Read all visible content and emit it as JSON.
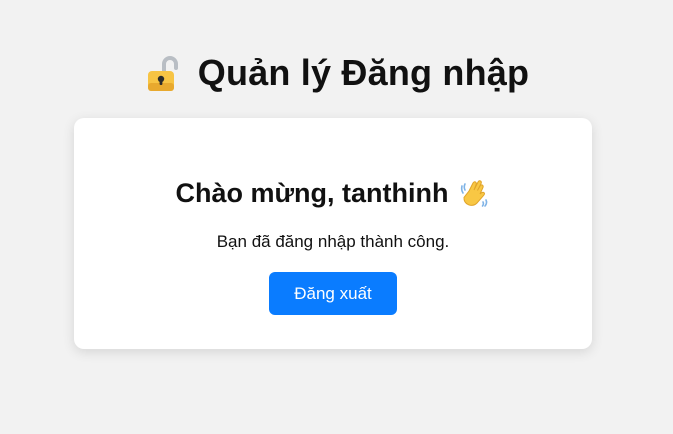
{
  "header": {
    "icon": "lock-icon",
    "title": "Quản lý Đăng nhập"
  },
  "card": {
    "welcome": "Chào mừng, tanthinh",
    "welcome_icon": "waving-hand-icon",
    "message": "Bạn đã đăng nhập thành công.",
    "logout_label": "Đăng xuất"
  },
  "colors": {
    "background": "#f2f2f2",
    "card": "#ffffff",
    "primary_button": "#0a7cff",
    "lock_gold": "#f7c444",
    "lock_shackle": "#b9bec4"
  }
}
